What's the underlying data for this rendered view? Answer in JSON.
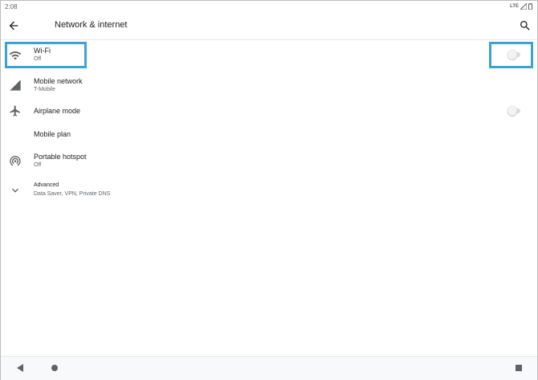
{
  "status_bar": {
    "time": "2:08",
    "network_type": "LTE",
    "icons": [
      "lte-icon",
      "signal-icon",
      "battery-icon"
    ]
  },
  "app_bar": {
    "title": "Network & internet",
    "back_icon": "back-arrow-icon",
    "search_icon": "search-icon"
  },
  "settings": {
    "wifi": {
      "label": "Wi-Fi",
      "summary": "Off",
      "icon": "wifi-icon",
      "toggle_on": false
    },
    "mobile_network": {
      "label": "Mobile network",
      "summary": "T-Mobile",
      "icon": "cell-signal-icon"
    },
    "airplane_mode": {
      "label": "Airplane mode",
      "icon": "airplane-icon",
      "toggle_on": false
    },
    "mobile_plan": {
      "label": "Mobile plan"
    },
    "hotspot": {
      "label": "Portable hotspot",
      "summary": "Off",
      "icon": "hotspot-icon"
    },
    "advanced": {
      "label": "Advanced",
      "summary": "Data Saver, VPN, Private DNS",
      "icon": "chevron-down-icon"
    }
  },
  "nav_bar": {
    "icons": [
      "nav-back-icon",
      "nav-home-icon",
      "nav-recents-icon"
    ]
  },
  "colors": {
    "highlight": "#3aa3d6",
    "icon": "#5f6368",
    "text_primary": "#202124",
    "text_secondary": "#5f6368"
  }
}
